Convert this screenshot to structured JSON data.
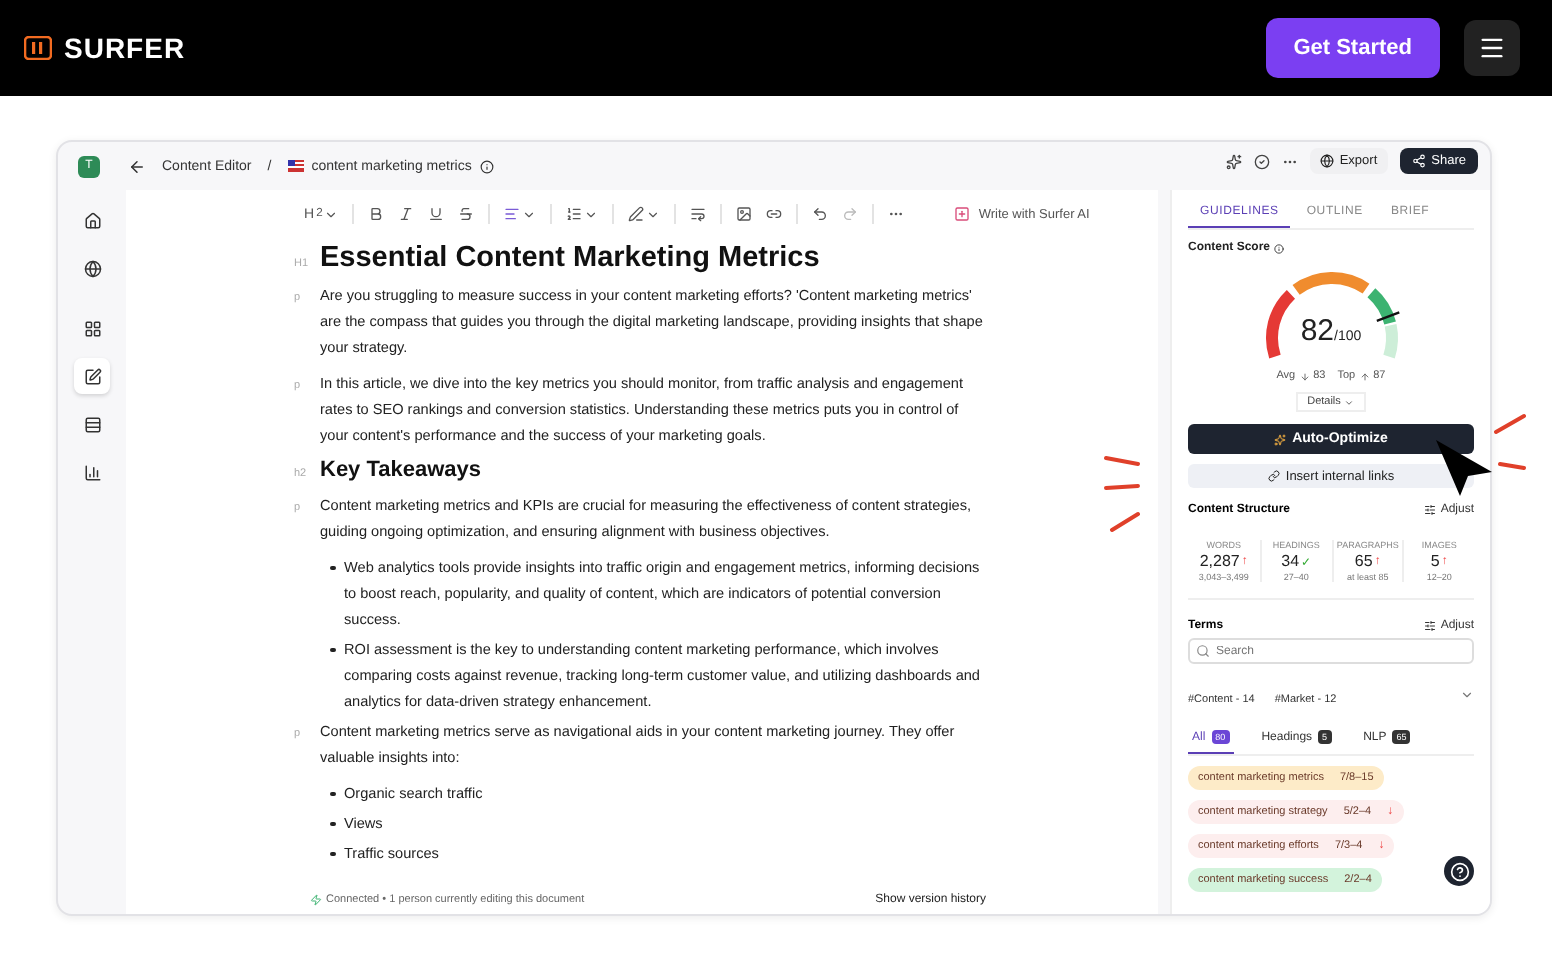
{
  "site": {
    "logo": "SURFER",
    "cta": "Get Started"
  },
  "app": {
    "workspace_initial": "T",
    "breadcrumb": {
      "section": "Content Editor",
      "separator": "/",
      "document": "content marketing metrics"
    },
    "sidebar": [
      {
        "selected": false
      },
      {
        "selected": false
      },
      {
        "selected": false
      },
      {
        "selected": true
      },
      {
        "selected": false
      },
      {
        "selected": false
      }
    ],
    "toolbar": {
      "heading": "H",
      "heading_sub": "2",
      "ai_button": "Write with Surfer AI"
    },
    "blocks": [
      {
        "kind": "h1",
        "marker": "H1",
        "text": "Essential Content Marketing Metrics"
      },
      {
        "kind": "p",
        "marker": "p",
        "text": "Are you struggling to measure success in your content marketing efforts? 'Content marketing metrics' are the compass that guides you through the digital marketing landscape, providing insights that shape your strategy."
      },
      {
        "kind": "p",
        "marker": "p",
        "text": "In this article, we dive into the key metrics you should monitor, from traffic analysis and engagement rates to SEO rankings and conversion statistics. Understanding these metrics puts you in control of your content's performance and the success of your marketing goals."
      },
      {
        "kind": "h2",
        "marker": "h2",
        "text": "Key Takeaways"
      },
      {
        "kind": "p",
        "marker": "p",
        "text": "Content marketing metrics and KPIs are crucial for measuring the effectiveness of content strategies, guiding ongoing optimization, and ensuring alignment with business objectives."
      },
      {
        "kind": "bullet",
        "text": "Web analytics tools provide insights into traffic origin and engagement metrics, informing decisions to boost reach, popularity, and quality of content, which are indicators of potential conversion success."
      },
      {
        "kind": "bullet",
        "text": "ROI assessment is the key to understanding content marketing performance, which involves comparing costs against revenue, tracking long-term customer value, and utilizing dashboards and analytics for data-driven strategy enhancement."
      },
      {
        "kind": "p",
        "marker": "p",
        "text": "Content marketing metrics serve as navigational aids in your content marketing journey. They offer valuable insights into:"
      },
      {
        "kind": "bullet",
        "text": "Organic search traffic"
      },
      {
        "kind": "bullet",
        "text": "Views"
      },
      {
        "kind": "bullet",
        "text": "Traffic sources"
      }
    ],
    "status": {
      "connected": "Connected",
      "separator": "•",
      "editing": "1 person currently editing this document",
      "history": "Show version history"
    },
    "actions": {
      "export": "Export",
      "share": "Share"
    },
    "panel": {
      "tabs": [
        {
          "label": "GUIDELINES",
          "selected": true
        },
        {
          "label": "OUTLINE",
          "selected": false
        },
        {
          "label": "BRIEF",
          "selected": false
        }
      ],
      "score_label": "Content Score",
      "score": "82",
      "score_max": "/100",
      "avg": "Avg",
      "avg_value": "83",
      "top": "Top",
      "top_value": "87",
      "details": "Details",
      "optimize": "Auto-Optimize",
      "internal_links": "Insert internal links",
      "structure_title": "Content Structure",
      "adjust": "Adjust",
      "stats": [
        {
          "label": "WORDS",
          "value": "2,287",
          "mark": "↑",
          "range": "3,043–3,499"
        },
        {
          "label": "HEADINGS",
          "value": "34",
          "mark": "✓",
          "range": "27–40"
        },
        {
          "label": "PARAGRAPHS",
          "value": "65",
          "mark": "↑",
          "range": "at least 85"
        },
        {
          "label": "IMAGES",
          "value": "5",
          "mark": "↑",
          "range": "12–20"
        }
      ],
      "terms_title": "Terms",
      "terms_adjust": "Adjust",
      "search_placeholder": "Search",
      "hashtags": [
        "#Content - 14",
        "#Market - 12"
      ],
      "filters": [
        {
          "label": "All",
          "count": "80",
          "selected": true
        },
        {
          "label": "Headings",
          "count": "5",
          "selected": false
        },
        {
          "label": "NLP",
          "count": "65",
          "selected": false
        }
      ],
      "terms": [
        {
          "text": "content marketing metrics",
          "count": "7/8–15",
          "color": "#fdebc8"
        },
        {
          "text": "content marketing strategy",
          "count": "5/2–4",
          "color": "#fdeeee",
          "mark": "↓"
        },
        {
          "text": "content marketing efforts",
          "count": "7/3–4",
          "color": "#fdeeee",
          "mark": "↓"
        },
        {
          "text": "content marketing success",
          "count": "2/2–4",
          "color": "#d3f3dc"
        }
      ]
    }
  }
}
